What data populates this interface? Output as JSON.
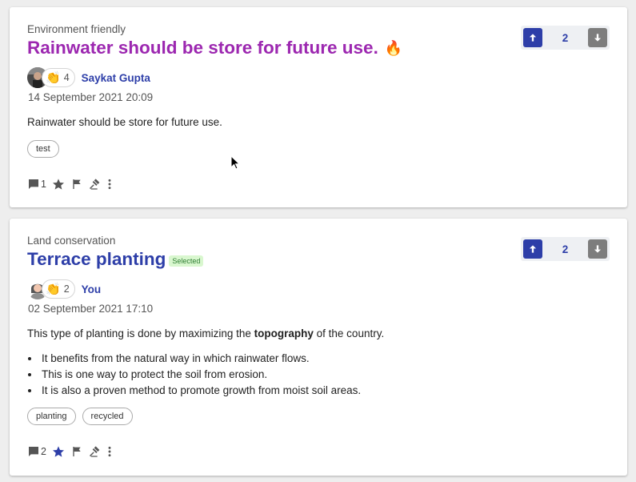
{
  "colors": {
    "accent": "#2d3ea8",
    "title_purple": "#9c27b0",
    "vote_down": "#7d7d7d",
    "selected_bg": "#d9f7cf"
  },
  "posts": [
    {
      "category": "Environment friendly",
      "title": "Rainwater should be store for future use.",
      "title_icon": "fire-icon",
      "claps": "4",
      "author": "Saykat Gupta",
      "date": "14 September 2021 20:09",
      "body": "Rainwater should be store for future use.",
      "tags": [
        "test"
      ],
      "comments": "1",
      "starred": false,
      "votes": "2"
    },
    {
      "category": "Land conservation",
      "title": "Terrace planting",
      "badge": "Selected",
      "claps": "2",
      "author": "You",
      "date": "02 September 2021 17:10",
      "body_prefix": "This type of planting is done by maximizing the ",
      "body_bold": "topography",
      "body_suffix": " of the country.",
      "bullets": [
        "It benefits from the natural way in which rainwater flows.",
        "This is one way to protect the soil from erosion.",
        "It is also a proven method to promote growth from moist soil areas."
      ],
      "tags": [
        "planting",
        "recycled"
      ],
      "comments": "2",
      "starred": true,
      "votes": "2"
    }
  ]
}
